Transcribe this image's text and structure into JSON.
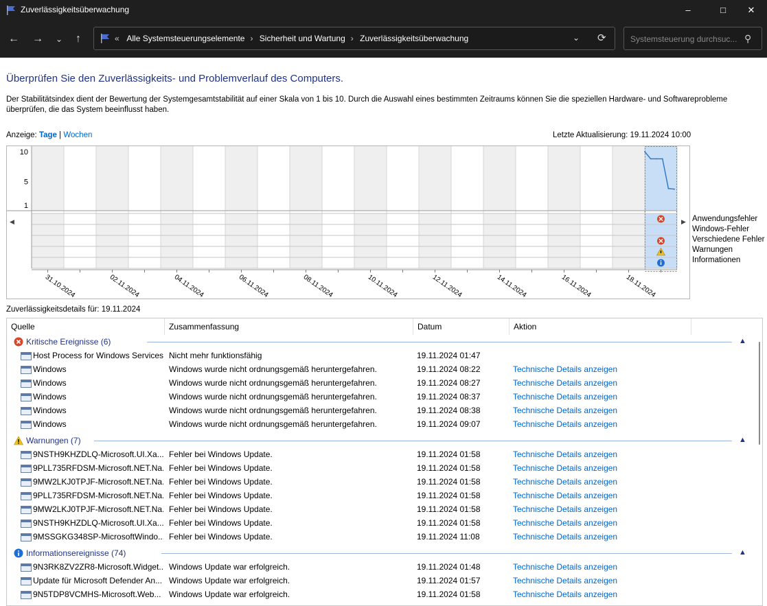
{
  "window": {
    "title": "Zuverlässigkeitsüberwachung"
  },
  "nav": {
    "breadcrumb": [
      "Alle Systemsteuerungselemente",
      "Sicherheit und Wartung",
      "Zuverlässigkeitsüberwachung"
    ],
    "search_placeholder": "Systemsteuerung durchsuc..."
  },
  "page": {
    "heading": "Überprüfen Sie den Zuverlässigkeits- und Problemverlauf des Computers.",
    "description": "Der Stabilitätsindex dient der Bewertung der Systemgesamtstabilität auf einer Skala von 1 bis 10. Durch die Auswahl eines bestimmten Zeitraums können Sie die speziellen Hardware- und Softwareprobleme überprüfen, die das System beeinflusst haben.",
    "view_label": "Anzeige:",
    "view_days": "Tage",
    "view_sep": "|",
    "view_weeks": "Wochen",
    "last_update": "Letzte Aktualisierung: 19.11.2024 10:00",
    "details_label": "Zuverlässigkeitsdetails für: 19.11.2024"
  },
  "chart_data": {
    "type": "line",
    "y_ticks": [
      "10",
      "5",
      "1"
    ],
    "ylim": [
      1,
      10
    ],
    "x_tick_labels": [
      "31.10.2024",
      "02.11.2024",
      "04.11.2024",
      "06.11.2024",
      "08.11.2024",
      "10.11.2024",
      "12.11.2024",
      "14.11.2024",
      "16.11.2024",
      "18.11.2024"
    ],
    "day_count": 20,
    "selected_day": "19.11.2024",
    "stability_index": [
      10,
      8.8,
      8.8,
      8.8,
      3.8,
      3.7
    ],
    "event_rows": [
      "Anwendungsfehler",
      "Windows-Fehler",
      "Verschiedene Fehler",
      "Warnungen",
      "Informationen"
    ],
    "selected_day_events": {
      "Anwendungsfehler": "error",
      "Windows-Fehler": "",
      "Verschiedene Fehler": "error",
      "Warnungen": "warning",
      "Informationen": "info"
    }
  },
  "table": {
    "columns": [
      "Quelle",
      "Zusammenfassung",
      "Datum",
      "Aktion"
    ],
    "groups": [
      {
        "label": "Kritische Ereignisse (6)",
        "icon": "error-icon",
        "rows": [
          {
            "source": "Host Process for Windows Services",
            "summary": "Nicht mehr funktionsfähig",
            "date": "19.11.2024 01:47",
            "action": ""
          },
          {
            "source": "Windows",
            "summary": "Windows wurde nicht ordnungsgemäß heruntergefahren.",
            "date": "19.11.2024 08:22",
            "action": "Technische Details anzeigen"
          },
          {
            "source": "Windows",
            "summary": "Windows wurde nicht ordnungsgemäß heruntergefahren.",
            "date": "19.11.2024 08:27",
            "action": "Technische Details anzeigen"
          },
          {
            "source": "Windows",
            "summary": "Windows wurde nicht ordnungsgemäß heruntergefahren.",
            "date": "19.11.2024 08:37",
            "action": "Technische Details anzeigen"
          },
          {
            "source": "Windows",
            "summary": "Windows wurde nicht ordnungsgemäß heruntergefahren.",
            "date": "19.11.2024 08:38",
            "action": "Technische Details anzeigen"
          },
          {
            "source": "Windows",
            "summary": "Windows wurde nicht ordnungsgemäß heruntergefahren.",
            "date": "19.11.2024 09:07",
            "action": "Technische Details anzeigen"
          }
        ]
      },
      {
        "label": "Warnungen (7)",
        "icon": "warning-icon",
        "rows": [
          {
            "source": "9NSTH9KHZDLQ-Microsoft.UI.Xa...",
            "summary": "Fehler bei Windows Update.",
            "date": "19.11.2024 01:58",
            "action": "Technische Details anzeigen"
          },
          {
            "source": "9PLL735RFDSM-Microsoft.NET.Na...",
            "summary": "Fehler bei Windows Update.",
            "date": "19.11.2024 01:58",
            "action": "Technische Details anzeigen"
          },
          {
            "source": "9MW2LKJ0TPJF-Microsoft.NET.Na...",
            "summary": "Fehler bei Windows Update.",
            "date": "19.11.2024 01:58",
            "action": "Technische Details anzeigen"
          },
          {
            "source": "9PLL735RFDSM-Microsoft.NET.Na...",
            "summary": "Fehler bei Windows Update.",
            "date": "19.11.2024 01:58",
            "action": "Technische Details anzeigen"
          },
          {
            "source": "9MW2LKJ0TPJF-Microsoft.NET.Na...",
            "summary": "Fehler bei Windows Update.",
            "date": "19.11.2024 01:58",
            "action": "Technische Details anzeigen"
          },
          {
            "source": "9NSTH9KHZDLQ-Microsoft.UI.Xa...",
            "summary": "Fehler bei Windows Update.",
            "date": "19.11.2024 01:58",
            "action": "Technische Details anzeigen"
          },
          {
            "source": "9MSSGKG348SP-MicrosoftWindo...",
            "summary": "Fehler bei Windows Update.",
            "date": "19.11.2024 11:08",
            "action": "Technische Details anzeigen"
          }
        ]
      },
      {
        "label": "Informationsereignisse (74)",
        "icon": "info-icon",
        "rows": [
          {
            "source": "9N3RK8ZV2ZR8-Microsoft.Widget...",
            "summary": "Windows Update war erfolgreich.",
            "date": "19.11.2024 01:48",
            "action": "Technische Details anzeigen"
          },
          {
            "source": "Update für Microsoft Defender An...",
            "summary": "Windows Update war erfolgreich.",
            "date": "19.11.2024 01:57",
            "action": "Technische Details anzeigen"
          },
          {
            "source": "9N5TDP8VCMHS-Microsoft.Web...",
            "summary": "Windows Update war erfolgreich.",
            "date": "19.11.2024 01:58",
            "action": "Technische Details anzeigen"
          }
        ]
      }
    ]
  }
}
